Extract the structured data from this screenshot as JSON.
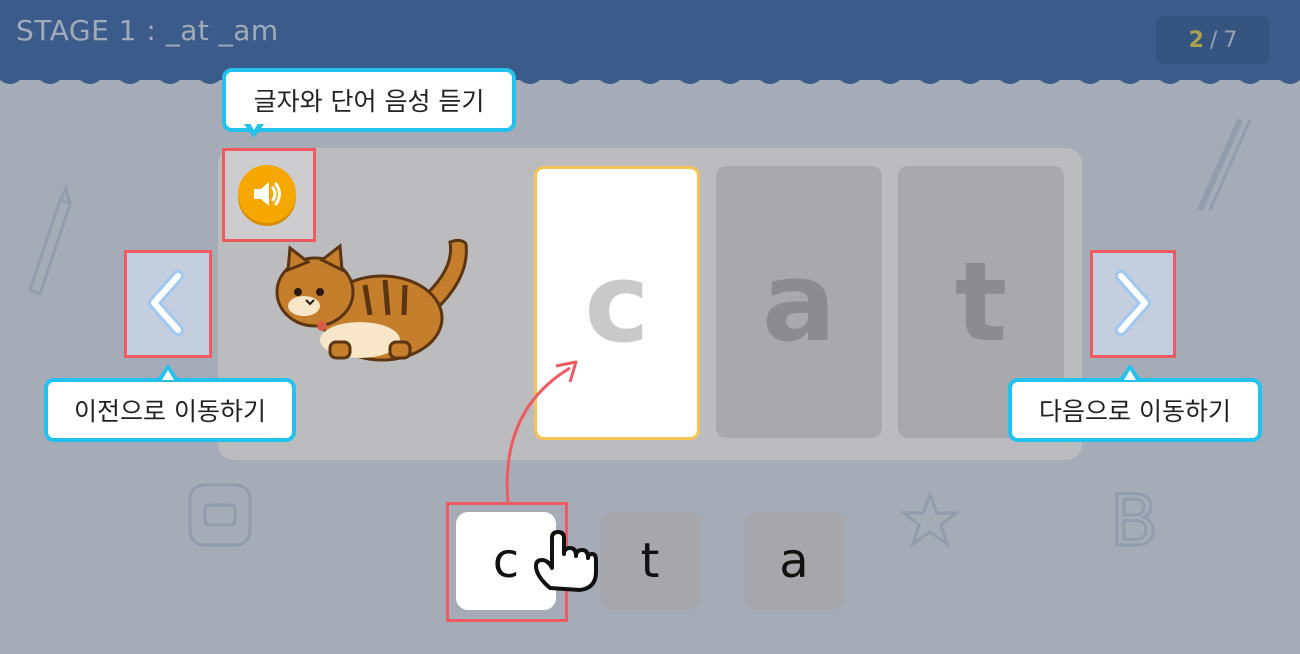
{
  "header": {
    "stage_title": "STAGE 1 : _at _am",
    "progress_current": "2",
    "progress_separator": "/",
    "progress_total": "7"
  },
  "word": {
    "image_icon": "cat-illustration",
    "letters": [
      "c",
      "a",
      "t"
    ],
    "active_index": 0
  },
  "tiles": [
    "c",
    "t",
    "a"
  ],
  "callouts": {
    "speaker": "글자와 단어 음성 듣기",
    "prev": "이전으로 이동하기",
    "next": "다음으로 이동하기"
  },
  "icons": {
    "speaker": "speaker-icon",
    "prev": "chevron-left-icon",
    "next": "chevron-right-icon",
    "hand": "pointing-hand-icon"
  },
  "colors": {
    "header": "#3566a8",
    "speaker": "#f7a800",
    "callout_border": "#23c2ee",
    "highlight": "#ef5a60",
    "active_slot_border": "#f6c453"
  }
}
